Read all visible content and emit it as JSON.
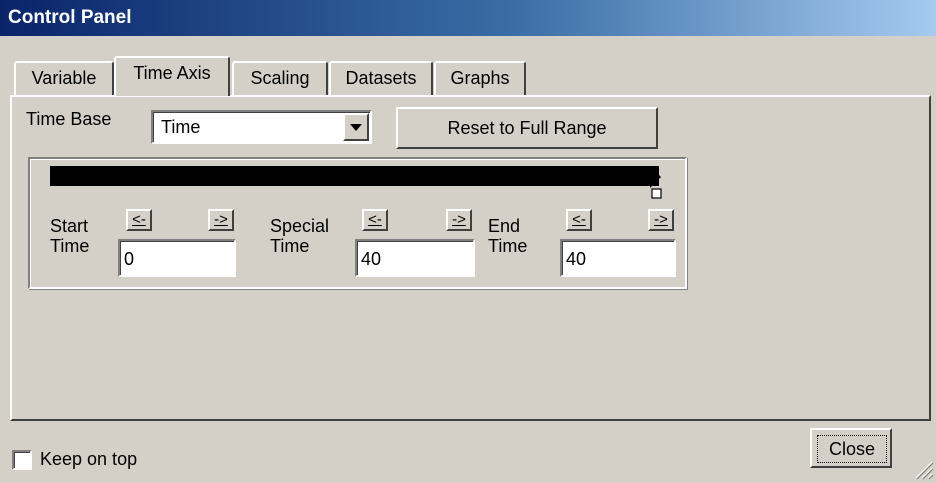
{
  "window": {
    "title": "Control Panel"
  },
  "tabs": [
    {
      "label": "Variable",
      "active": false
    },
    {
      "label": "Time Axis",
      "active": true
    },
    {
      "label": "Scaling",
      "active": false
    },
    {
      "label": "Datasets",
      "active": false
    },
    {
      "label": "Graphs",
      "active": false
    }
  ],
  "time_base": {
    "label": "Time Base",
    "selected": "Time"
  },
  "reset_button": {
    "label": "Reset to Full Range"
  },
  "slider": {
    "position_fraction": 1.0
  },
  "start_time": {
    "label_line1": "Start",
    "label_line2": "Time",
    "value": "0",
    "prev_label": "<-",
    "next_label": "->"
  },
  "special_time": {
    "label_line1": "Special",
    "label_line2": "Time",
    "value": "40",
    "prev_label": "<-",
    "next_label": "->"
  },
  "end_time": {
    "label_line1": "End",
    "label_line2": "Time",
    "value": "40",
    "prev_label": "<-",
    "next_label": "->"
  },
  "keep_on_top": {
    "label": "Keep on top",
    "checked": false
  },
  "close_button": {
    "label": "Close"
  },
  "colors": {
    "title_start": "#0a246a",
    "title_end": "#a6caf0",
    "face": "#d4d0c8"
  }
}
